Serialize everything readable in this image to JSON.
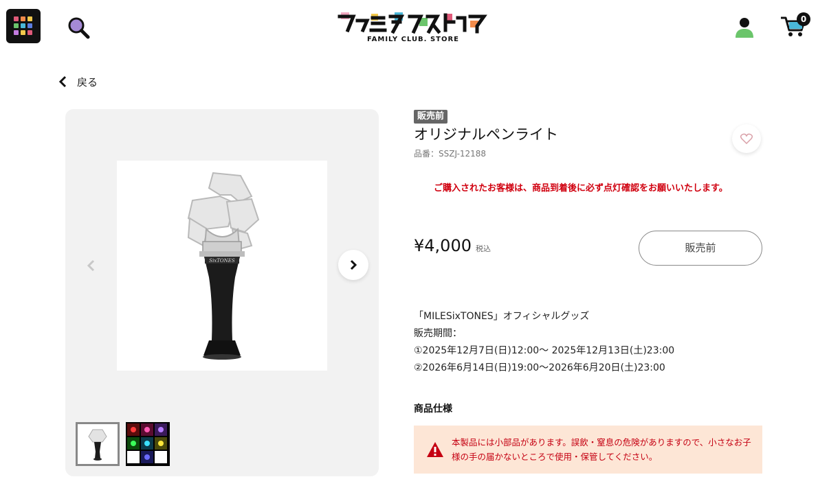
{
  "header": {
    "logo_sub": "FAMILY CLUB. STORE",
    "logo_name": "ファミクラストア",
    "cart_count": "0"
  },
  "nav": {
    "back_label": "戻る"
  },
  "product": {
    "badge": "販売前",
    "title": "オリジナルペンライト",
    "code": "品番：SSZJ-12188",
    "notice": "ご購入されたお客様は、商品到着後に必ず点灯確認をお願いいたします。",
    "price": "¥4,000",
    "tax_label": "税込",
    "status_button": "販売前",
    "description": {
      "line1": "「MILESixTONES」オフィシャルグッズ",
      "line2": "販売期間：",
      "line3": "①2025年12月7日(日)12:00～ 2025年12月13日(土)23:00",
      "line4": "②2026年6月14日(日)19:00～2026年6月20日(土)23:00"
    },
    "spec_heading": "商品仕様",
    "warning": "本製品には小部品があります。誤飲・窒息の危険がありますので、小さなお子様の手の届かないところで使用・保管してください。"
  },
  "colors": {
    "accent_red": "#d0000f",
    "badge_gray": "#666666",
    "warning_bg": "#fde6d6"
  },
  "icons": [
    "menu-grid-icon",
    "search-icon",
    "user-icon",
    "cart-icon",
    "chevron-left-icon",
    "chevron-right-icon",
    "heart-icon",
    "warning-icon"
  ]
}
